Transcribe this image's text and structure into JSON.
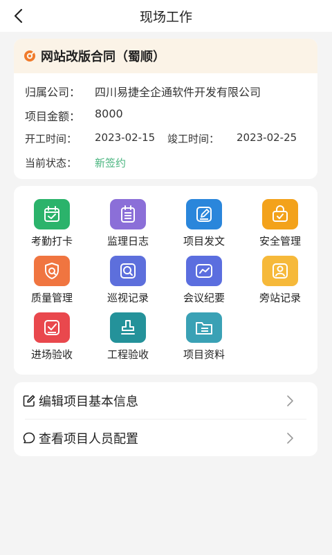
{
  "nav": {
    "title": "现场工作"
  },
  "project": {
    "name": "网站改版合同（蜀顺）",
    "company_label": "归属公司：",
    "company_value": "四川易捷全企通软件开发有限公司",
    "amount_label": "项目金额：",
    "amount_value": "8000",
    "start_label": "开工时间：",
    "start_value": "2023-02-15",
    "end_label": "竣工时间：",
    "end_value": "2023-02-25",
    "status_label": "当前状态：",
    "status_value": "新签约"
  },
  "grid": {
    "items": [
      {
        "label": "考勤打卡",
        "icon": "calendar-check-icon",
        "color": "#2bb36b"
      },
      {
        "label": "监理日志",
        "icon": "log-list-icon",
        "color": "#8b6fd8"
      },
      {
        "label": "项目发文",
        "icon": "edit-doc-icon",
        "color": "#2a86db"
      },
      {
        "label": "安全管理",
        "icon": "safety-bag-icon",
        "color": "#f3a21b"
      },
      {
        "label": "质量管理",
        "icon": "quality-shield-icon",
        "color": "#f07540"
      },
      {
        "label": "巡视记录",
        "icon": "inspect-search-icon",
        "color": "#5d6fdc"
      },
      {
        "label": "会议纪要",
        "icon": "meeting-chart-icon",
        "color": "#5b6edf"
      },
      {
        "label": "旁站记录",
        "icon": "person-icon",
        "color": "#f6b93a"
      },
      {
        "label": "进场验收",
        "icon": "entry-check-icon",
        "color": "#e9484d"
      },
      {
        "label": "工程验收",
        "icon": "stamp-icon",
        "color": "#24929a"
      },
      {
        "label": "项目资料",
        "icon": "folder-icon",
        "color": "#3aa1b5"
      }
    ]
  },
  "menu": {
    "edit_label": "编辑项目基本信息",
    "view_label": "查看项目人员配置"
  },
  "colors": {
    "status": "#49b57f",
    "header_bg": "#fbf3e7",
    "logo": "#f07a2a"
  }
}
